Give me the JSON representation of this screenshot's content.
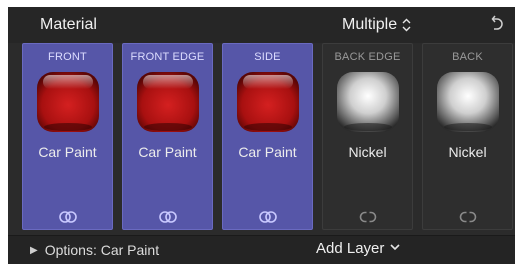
{
  "header": {
    "title": "Material",
    "selector_value": "Multiple",
    "selector_icon": "up-down-chevron-icon",
    "reset_icon": "undo-arrow-icon"
  },
  "layers": [
    {
      "label": "FRONT",
      "material": "Car Paint",
      "selected": true,
      "swatch": "red-paint",
      "link_icon": "linked-icon"
    },
    {
      "label": "FRONT EDGE",
      "material": "Car Paint",
      "selected": true,
      "swatch": "red-paint",
      "link_icon": "linked-icon"
    },
    {
      "label": "SIDE",
      "material": "Car Paint",
      "selected": true,
      "swatch": "red-paint",
      "link_icon": "linked-icon"
    },
    {
      "label": "BACK EDGE",
      "material": "Nickel",
      "selected": false,
      "swatch": "nickel",
      "link_icon": "unlinked-icon"
    },
    {
      "label": "BACK",
      "material": "Nickel",
      "selected": false,
      "swatch": "nickel",
      "link_icon": "unlinked-icon"
    }
  ],
  "footer": {
    "options_label": "Options: Car Paint",
    "add_layer_label": "Add Layer"
  },
  "colors": {
    "panel_bg": "#2b2b2b",
    "selected_card": "#5656a8",
    "car_paint_red": "#c01818",
    "nickel": "#9a9a9a"
  }
}
